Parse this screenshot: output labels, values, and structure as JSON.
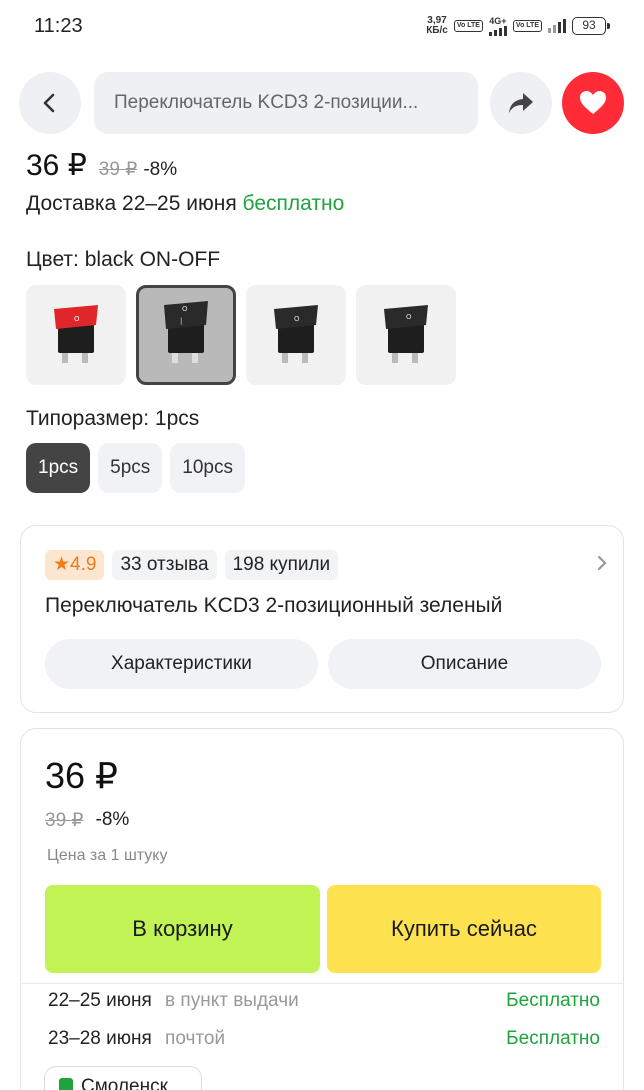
{
  "status_bar": {
    "time": "11:23",
    "speed_value": "3,97",
    "speed_unit": "КБ/с",
    "network": "4G+",
    "volte": "Vo LTE",
    "battery": "93"
  },
  "top_bar": {
    "search_text": "Переключатель KCD3 2-позиции..."
  },
  "product": {
    "price": "36 ₽",
    "old_price": "39 ₽",
    "discount": "-8%",
    "delivery_prefix": "Доставка 22–25 июня",
    "delivery_free": "бесплатно",
    "color_label": "Цвет: black ON-OFF",
    "size_label": "Типоразмер: 1pcs",
    "sizes": [
      "1pcs",
      "5pcs",
      "10pcs"
    ]
  },
  "info_card": {
    "rating": "4.9",
    "reviews": "33 отзыва",
    "bought": "198 купили",
    "title": "Переключатель KCD3 2-позиционный зеленый",
    "tab_specs": "Характеристики",
    "tab_description": "Описание"
  },
  "buy_card": {
    "price": "36 ₽",
    "old_price": "39 ₽",
    "discount": "-8%",
    "per_unit": "Цена за 1 штуку",
    "cart_button": "В корзину",
    "buy_button": "Купить сейчас",
    "delivery_options": [
      {
        "date": "22–25 июня",
        "method": "в пункт выдачи",
        "cost": "Бесплатно"
      },
      {
        "date": "23–28 июня",
        "method": "почтой",
        "cost": "Бесплатно"
      }
    ],
    "bottom_chip": "Смоленск"
  },
  "colors": {
    "accent_green": "#1fa33f",
    "cart_button": "#c2f354",
    "buy_button": "#fee250",
    "favorite": "#ff2c38",
    "rating_orange": "#f07b1a"
  }
}
